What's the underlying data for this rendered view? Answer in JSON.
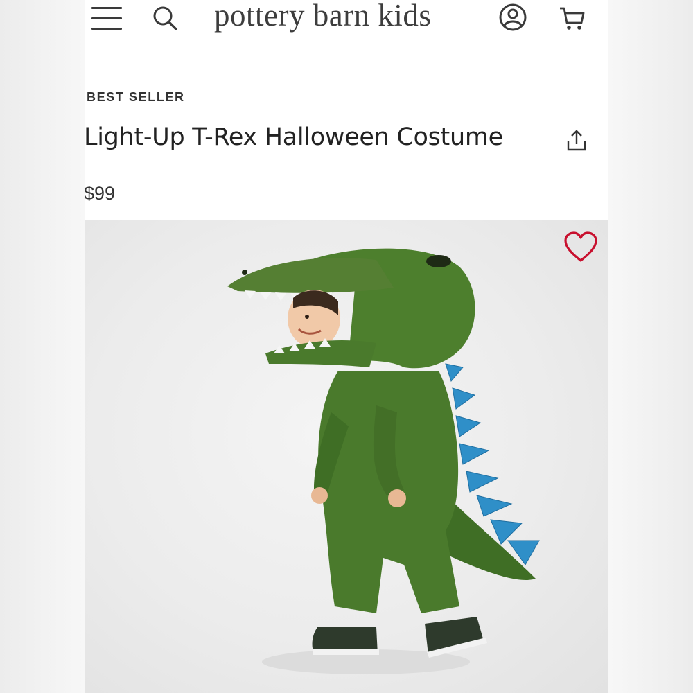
{
  "brand": "pottery barn kids",
  "product": {
    "badge": "BEST SELLER",
    "title": "Light-Up T-Rex Halloween Costume",
    "price": "$99",
    "image_alt": "Child wearing green T-Rex costume with blue spikes"
  },
  "icons": {
    "menu": "hamburger-menu-icon",
    "search": "search-icon",
    "account": "account-icon",
    "cart": "cart-icon",
    "share": "share-icon",
    "favorite": "heart-icon"
  },
  "colors": {
    "heart": "#c8102e",
    "costume_green": "#4a7a2c",
    "spikes": "#2f8fc8"
  }
}
